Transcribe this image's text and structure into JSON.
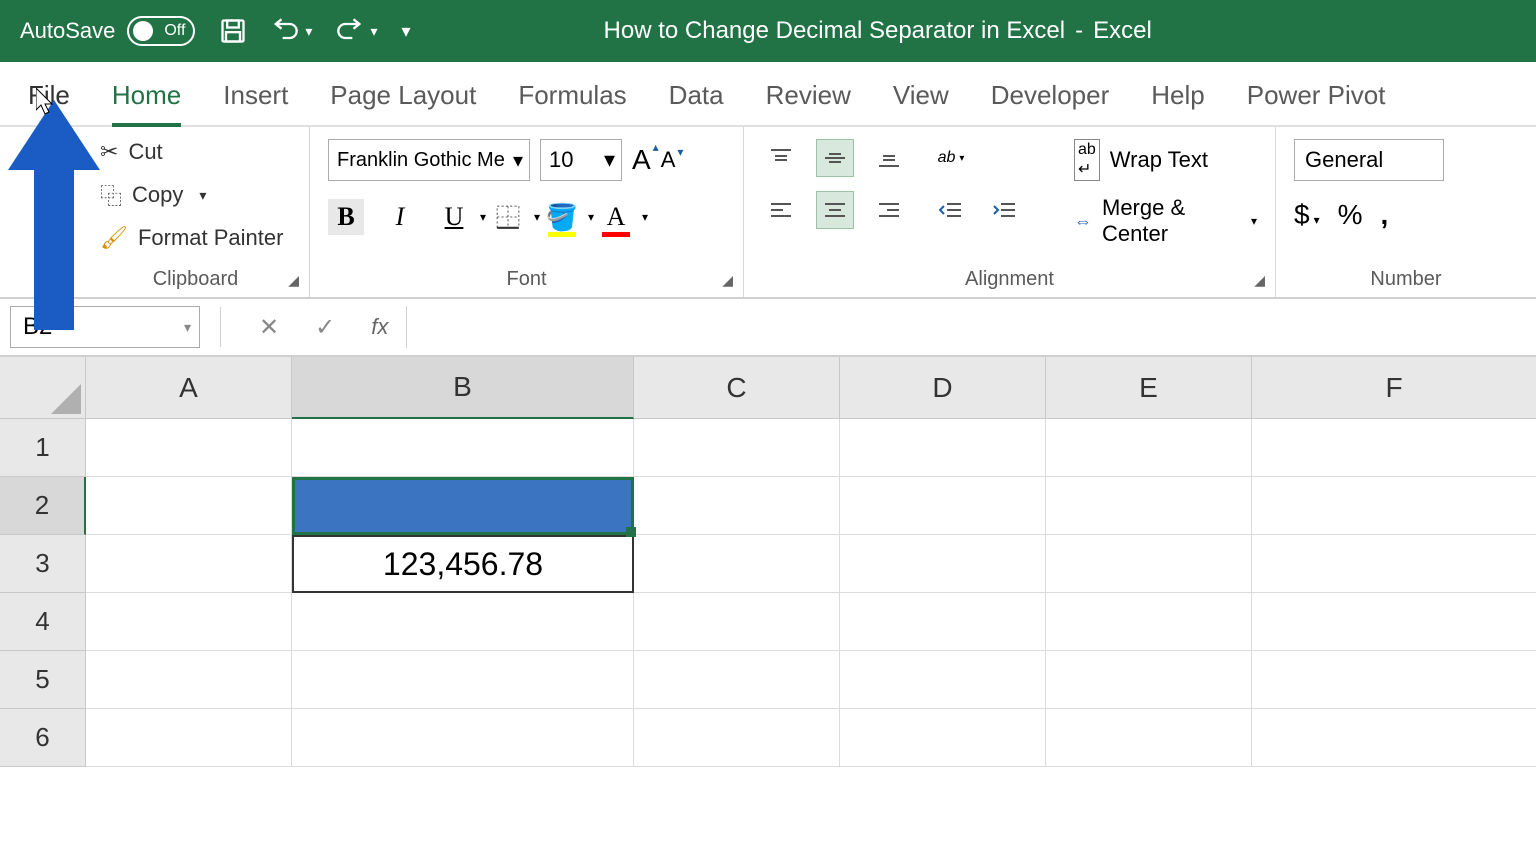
{
  "titlebar": {
    "autosave_label": "AutoSave",
    "autosave_state": "Off",
    "doc_title": "How to Change Decimal Separator in Excel",
    "app_name": "Excel"
  },
  "tabs": {
    "file": "File",
    "home": "Home",
    "insert": "Insert",
    "page_layout": "Page Layout",
    "formulas": "Formulas",
    "data": "Data",
    "review": "Review",
    "view": "View",
    "developer": "Developer",
    "help": "Help",
    "power_pivot": "Power Pivot"
  },
  "ribbon": {
    "clipboard": {
      "cut": "Cut",
      "copy": "Copy",
      "format_painter": "Format Painter",
      "group_label": "Clipboard"
    },
    "font": {
      "name": "Franklin Gothic Me",
      "size": "10",
      "group_label": "Font"
    },
    "alignment": {
      "wrap_text": "Wrap Text",
      "merge_center": "Merge & Center",
      "group_label": "Alignment"
    },
    "number": {
      "format": "General",
      "group_label": "Number"
    }
  },
  "formula_bar": {
    "name_box": "B2",
    "fx": "fx"
  },
  "grid": {
    "columns": [
      "A",
      "B",
      "C",
      "D",
      "E",
      "F"
    ],
    "rows": [
      "1",
      "2",
      "3",
      "4",
      "5",
      "6"
    ],
    "selected_cell": "B2",
    "data": {
      "B3": "123,456.78"
    }
  }
}
